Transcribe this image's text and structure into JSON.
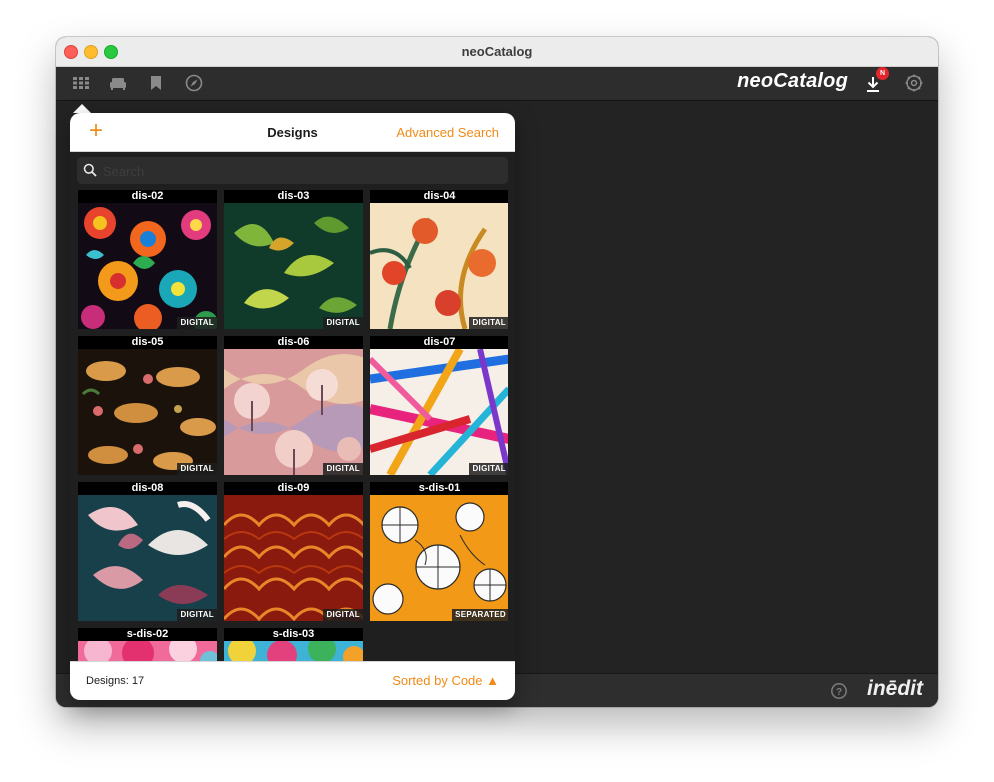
{
  "window": {
    "title": "neoCatalog"
  },
  "toolbar": {
    "brand": "neoCatalog",
    "icons": [
      "grid-icon",
      "sofa-icon",
      "bookmark-icon",
      "compass-icon"
    ],
    "download_badge": "N",
    "accent": "#f08a18"
  },
  "popover": {
    "title": "Designs",
    "add_label": "+",
    "advanced_search_label": "Advanced Search",
    "search": {
      "placeholder": "Search",
      "value": ""
    },
    "designs": [
      {
        "code": "dis-02",
        "badge": "DIGITAL"
      },
      {
        "code": "dis-03",
        "badge": "DIGITAL"
      },
      {
        "code": "dis-04",
        "badge": "DIGITAL"
      },
      {
        "code": "dis-05",
        "badge": "DIGITAL"
      },
      {
        "code": "dis-06",
        "badge": "DIGITAL"
      },
      {
        "code": "dis-07",
        "badge": "DIGITAL"
      },
      {
        "code": "dis-08",
        "badge": "DIGITAL"
      },
      {
        "code": "dis-09",
        "badge": "DIGITAL"
      },
      {
        "code": "s-dis-01",
        "badge": "SEPARATED"
      },
      {
        "code": "s-dis-02",
        "badge": ""
      },
      {
        "code": "s-dis-03",
        "badge": ""
      }
    ],
    "footer": {
      "count_label": "Designs: 17",
      "sort_label": "Sorted by Code ▲"
    }
  },
  "bottombar": {
    "logo": "inēdit"
  }
}
